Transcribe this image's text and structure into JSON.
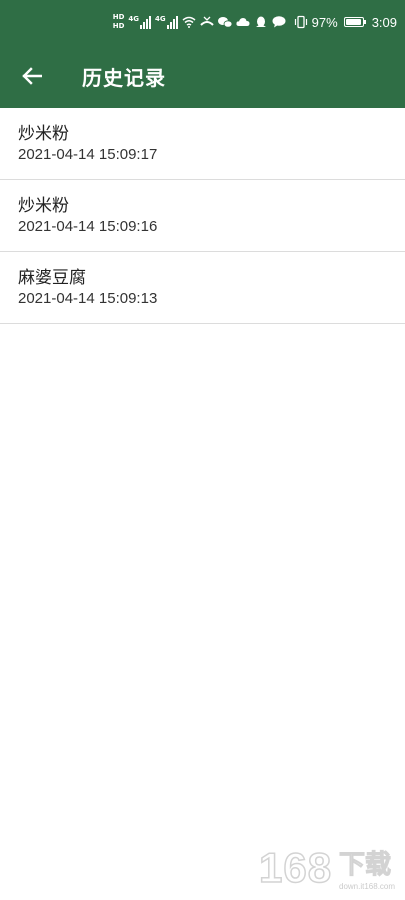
{
  "status_bar": {
    "hd_label_1": "HD",
    "hd_label_2": "HD",
    "network_1": "4G",
    "network_2": "4G",
    "battery_percent": "97%",
    "battery_level": 0.97,
    "time": "3:09",
    "icons": [
      "hd-icon",
      "signal-icon",
      "wifi-icon",
      "missed-call-icon",
      "wechat-icon",
      "cloud-icon",
      "qq-icon",
      "message-icon",
      "vibrate-icon",
      "battery-icon"
    ]
  },
  "toolbar": {
    "back_icon": "arrow-left-icon",
    "title": "历史记录"
  },
  "history": [
    {
      "name": "炒米粉",
      "time": "2021-04-14 15:09:17"
    },
    {
      "name": "炒米粉",
      "time": "2021-04-14 15:09:16"
    },
    {
      "name": "麻婆豆腐",
      "time": "2021-04-14 15:09:13"
    }
  ],
  "watermark": {
    "number": "168",
    "text": "下载",
    "url": "down.it168.com"
  },
  "colors": {
    "primary": "#2f6e45",
    "divider": "#dcdcdc",
    "text": "#222222"
  }
}
